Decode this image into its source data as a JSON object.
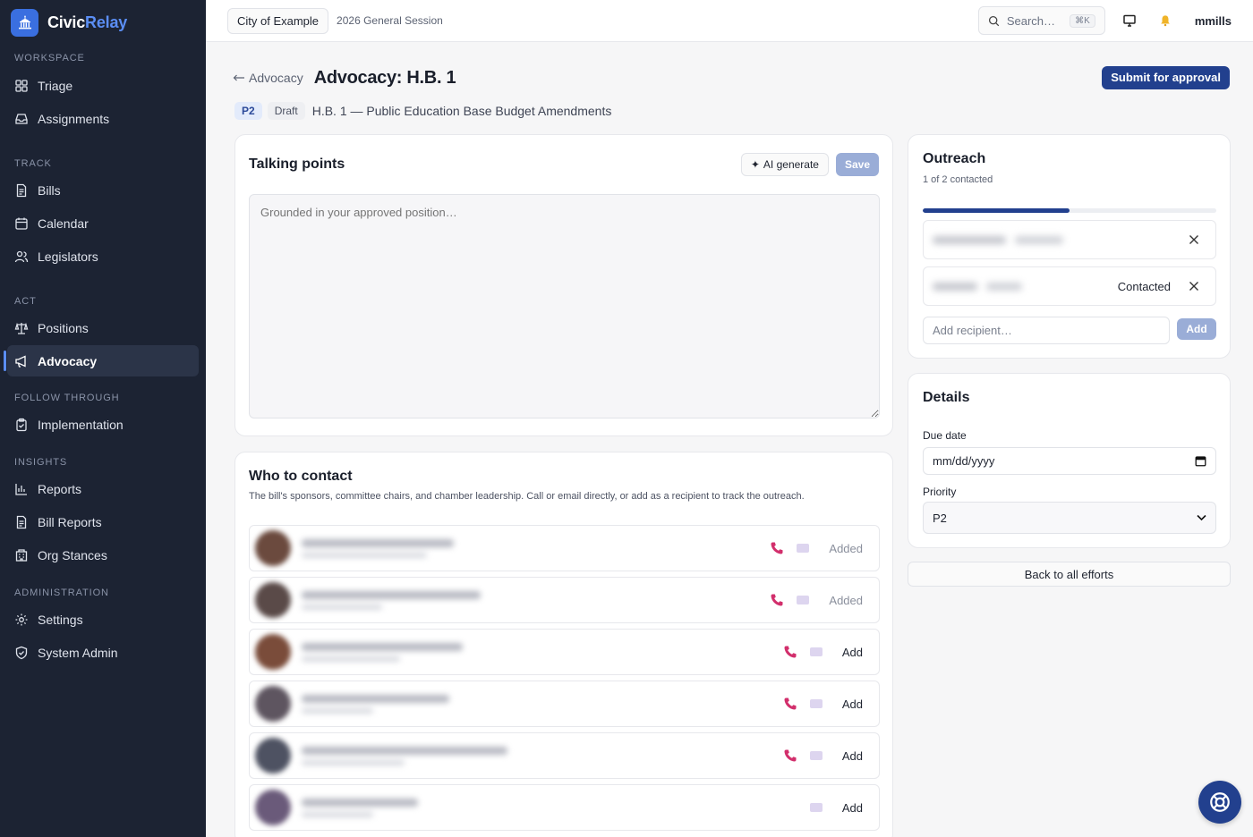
{
  "brand": {
    "name_part1": "Civic",
    "name_part2": "Relay"
  },
  "sidebar": {
    "sections": [
      {
        "label": "WORKSPACE",
        "items": [
          {
            "label": "Triage",
            "icon": "grid-icon"
          },
          {
            "label": "Assignments",
            "icon": "inbox-icon"
          }
        ]
      },
      {
        "label": "TRACK",
        "items": [
          {
            "label": "Bills",
            "icon": "document-icon"
          },
          {
            "label": "Calendar",
            "icon": "calendar-icon"
          },
          {
            "label": "Legislators",
            "icon": "users-icon"
          }
        ]
      },
      {
        "label": "ACT",
        "items": [
          {
            "label": "Positions",
            "icon": "scale-icon"
          },
          {
            "label": "Advocacy",
            "icon": "megaphone-icon",
            "active": true
          }
        ]
      },
      {
        "label": "FOLLOW THROUGH",
        "items": [
          {
            "label": "Implementation",
            "icon": "clipboard-icon"
          }
        ]
      },
      {
        "label": "INSIGHTS",
        "items": [
          {
            "label": "Reports",
            "icon": "bar-chart-icon"
          },
          {
            "label": "Bill Reports",
            "icon": "document-icon"
          },
          {
            "label": "Org Stances",
            "icon": "building-icon"
          }
        ]
      },
      {
        "label": "ADMINISTRATION",
        "items": [
          {
            "label": "Settings",
            "icon": "gear-icon"
          },
          {
            "label": "System Admin",
            "icon": "shield-icon"
          }
        ]
      }
    ]
  },
  "topbar": {
    "org": "City of Example",
    "session": "2026 General Session",
    "search_placeholder": "Search…",
    "search_shortcut": "⌘K",
    "user": "mmills"
  },
  "header": {
    "back_label": "Advocacy",
    "title": "Advocacy: H.B. 1",
    "submit_label": "Submit for approval",
    "priority_tag": "P2",
    "status_tag": "Draft",
    "bill_name": "H.B. 1 — Public Education Base Budget Amendments"
  },
  "talking_points": {
    "title": "Talking points",
    "ai_label": "AI generate",
    "save_label": "Save",
    "placeholder": "Grounded in your approved position…"
  },
  "who_to_contact": {
    "title": "Who to contact",
    "subtitle": "The bill's sponsors, committee chairs, and chamber leadership. Call or email directly, or add as a recipient to track the outreach.",
    "contacts": [
      {
        "status": "Added",
        "has_phone": true,
        "avatar_color": "#6b4a3e"
      },
      {
        "status": "Added",
        "has_phone": true,
        "avatar_color": "#5a4a48"
      },
      {
        "status": "Add",
        "has_phone": true,
        "avatar_color": "#7a4c3a"
      },
      {
        "status": "Add",
        "has_phone": true,
        "avatar_color": "#5e5560"
      },
      {
        "status": "Add",
        "has_phone": true,
        "avatar_color": "#4e5262"
      },
      {
        "status": "Add",
        "has_phone": false,
        "avatar_color": "#6a5a7a"
      }
    ]
  },
  "outreach": {
    "title": "Outreach",
    "summary": "1 of 2 contacted",
    "progress": 0.5,
    "recipients": [
      {
        "status": ""
      },
      {
        "status": "Contacted"
      }
    ],
    "add_placeholder": "Add recipient…",
    "add_label": "Add"
  },
  "details": {
    "title": "Details",
    "due_label": "Due date",
    "due_value": "mm/dd/yyyy",
    "priority_label": "Priority",
    "priority_value": "P2"
  },
  "back_all_label": "Back to all efforts",
  "colors": {
    "sidebar_bg": "#1c2333",
    "primary": "#22408e",
    "accent": "#5b8ef5",
    "phone": "#d22f6c"
  }
}
